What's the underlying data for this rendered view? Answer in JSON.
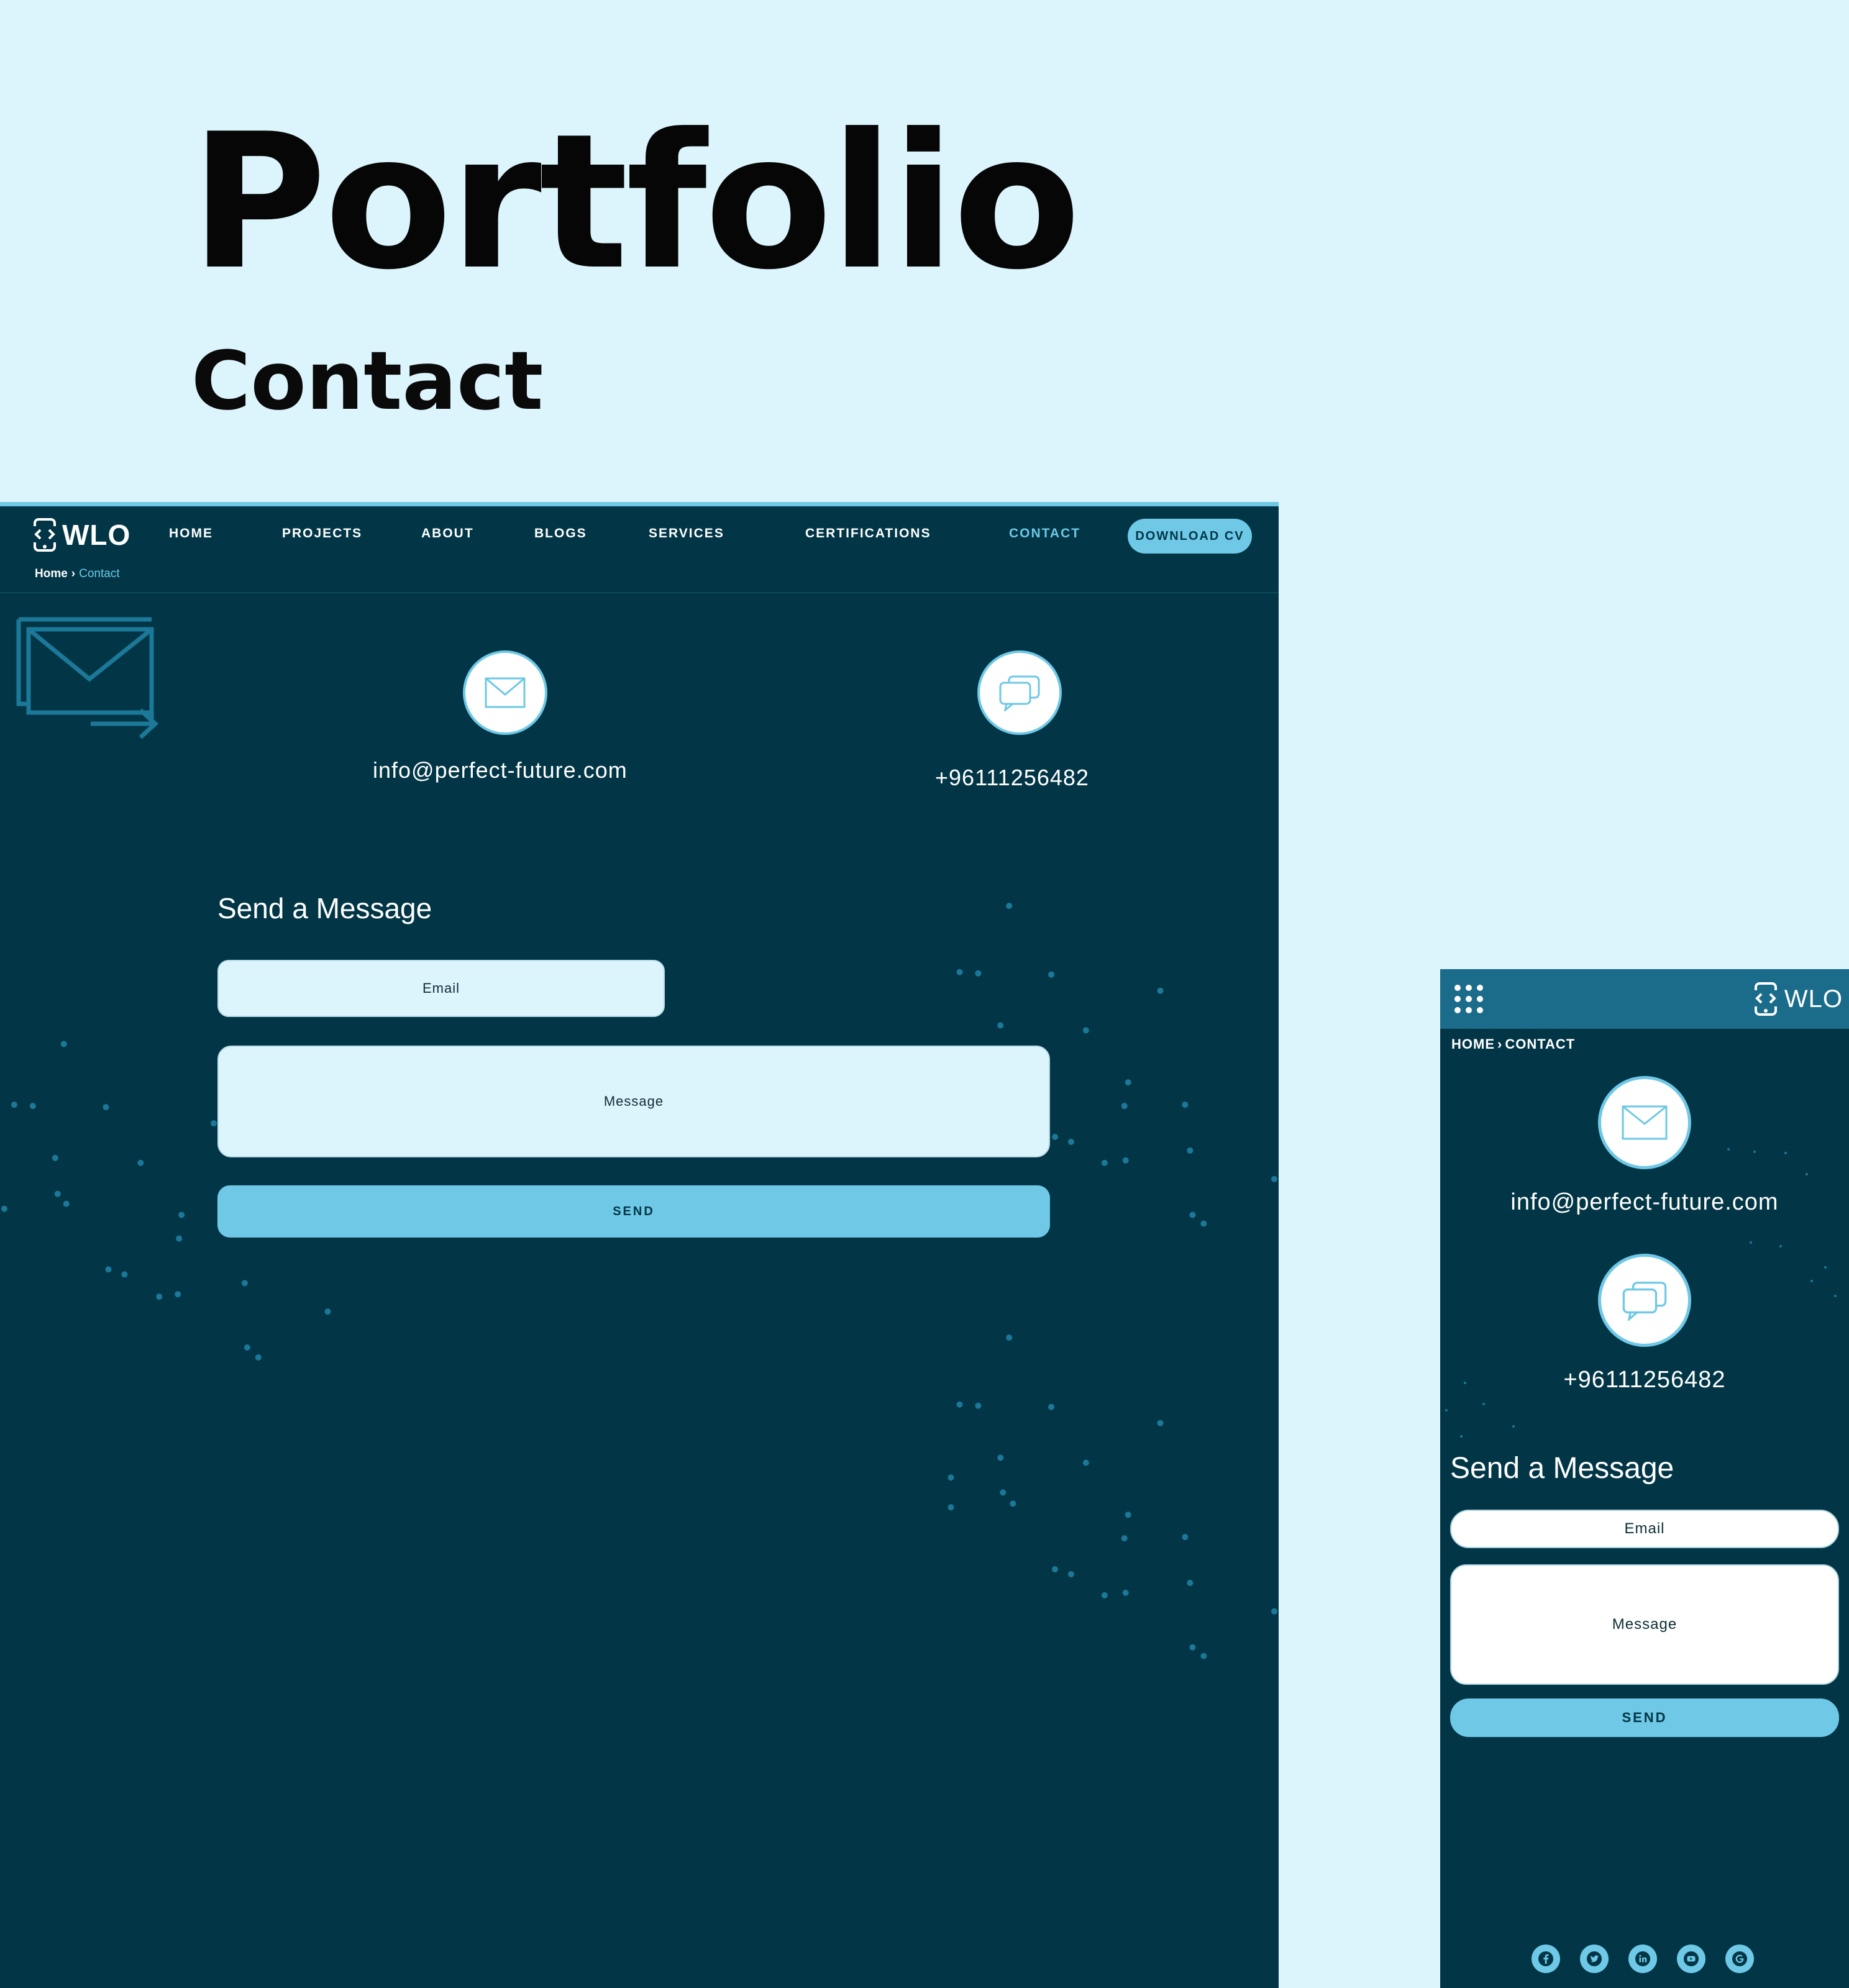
{
  "hero": {
    "title": "Portfolio",
    "subtitle": "Contact"
  },
  "colors": {
    "background": "#dcf4fc",
    "panel": "#023646",
    "accent": "#6ec8e6",
    "mobile_header": "#1a6c8a"
  },
  "desktop": {
    "logo": {
      "text": "WLO",
      "icon": "phone-code-icon"
    },
    "nav": [
      "HOME",
      "PROJECTS",
      "ABOUT",
      "BLOGS",
      "SERVICES",
      "CERTIFICATIONS",
      "CONTACT"
    ],
    "active_nav": "CONTACT",
    "cv_button": "DOWNLOAD CV",
    "breadcrumb": {
      "home": "Home",
      "current": "Contact"
    },
    "email": "info@perfect-future.com",
    "phone": "+96111256482",
    "form": {
      "title": "Send a Message",
      "email_placeholder": "Email",
      "message_placeholder": "Message",
      "send_label": "SEND"
    }
  },
  "mobile": {
    "logo": {
      "text": "WLO",
      "icon": "phone-code-icon"
    },
    "menu_icon": "grid-menu-icon",
    "breadcrumb": {
      "home": "HOME",
      "current": "CONTACT"
    },
    "email": "info@perfect-future.com",
    "phone": "+96111256482",
    "form": {
      "title": "Send a Message",
      "email_placeholder": "Email",
      "message_placeholder": "Message",
      "send_label": "SEND"
    },
    "social_icons": [
      "facebook-icon",
      "twitter-icon",
      "linkedin-icon",
      "youtube-icon",
      "google-icon"
    ]
  }
}
